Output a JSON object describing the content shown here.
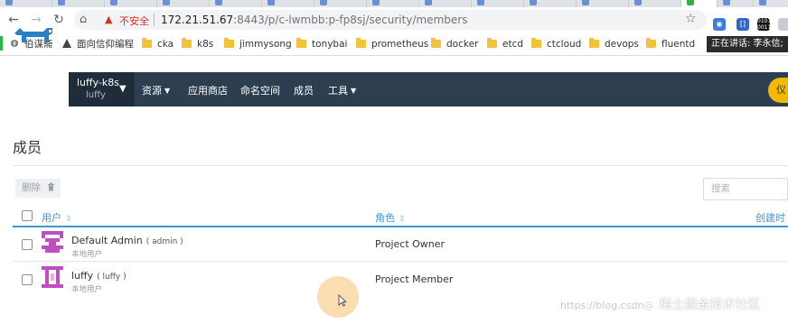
{
  "browser": {
    "security_label": "不安全",
    "url_host": "172.21.51.67",
    "url_rest": ":8443/p/c-lwmbb:p-fp8sj/security/members"
  },
  "bookmarks": [
    {
      "label": "伯谋斋",
      "type": "site"
    },
    {
      "label": "面向信仰编程",
      "type": "site"
    },
    {
      "label": "cka",
      "type": "folder"
    },
    {
      "label": "k8s",
      "type": "folder"
    },
    {
      "label": "jimmysong",
      "type": "folder"
    },
    {
      "label": "tonybai",
      "type": "folder"
    },
    {
      "label": "prometheus",
      "type": "folder"
    },
    {
      "label": "docker",
      "type": "folder"
    },
    {
      "label": "etcd",
      "type": "folder"
    },
    {
      "label": "ctcloud",
      "type": "folder"
    },
    {
      "label": "devops",
      "type": "folder"
    },
    {
      "label": "fluentd",
      "type": "folder"
    }
  ],
  "speaking_badge": "正在讲话: 李永信;",
  "app": {
    "context": {
      "cluster": "luffy-k8s",
      "project": "luffy"
    },
    "menu": [
      {
        "label": "资源",
        "dropdown": true
      },
      {
        "label": "应用商店",
        "dropdown": false
      },
      {
        "label": "命名空间",
        "dropdown": false
      },
      {
        "label": "成员",
        "dropdown": false
      },
      {
        "label": "工具",
        "dropdown": true
      }
    ],
    "user_button": "仪"
  },
  "page": {
    "title": "成员",
    "delete_label": "删除",
    "search_placeholder": "搜索",
    "columns": [
      "用户",
      "角色",
      "创建时"
    ],
    "rows": [
      {
        "name": "Default Admin",
        "username": "( admin )",
        "source": "本地用户",
        "role": "Project Owner"
      },
      {
        "name": "luffy",
        "username": "( luffy )",
        "source": "本地用户",
        "role": "Project Member"
      }
    ]
  },
  "watermark": {
    "site": "https://blog.csdn",
    "at": "@",
    "brand": "稀土掘金技术社区"
  },
  "colors": {
    "nav": "#2c3e50",
    "accent": "#3d98d3",
    "avatar": "#c04ec0",
    "cta": "#f5b800"
  }
}
